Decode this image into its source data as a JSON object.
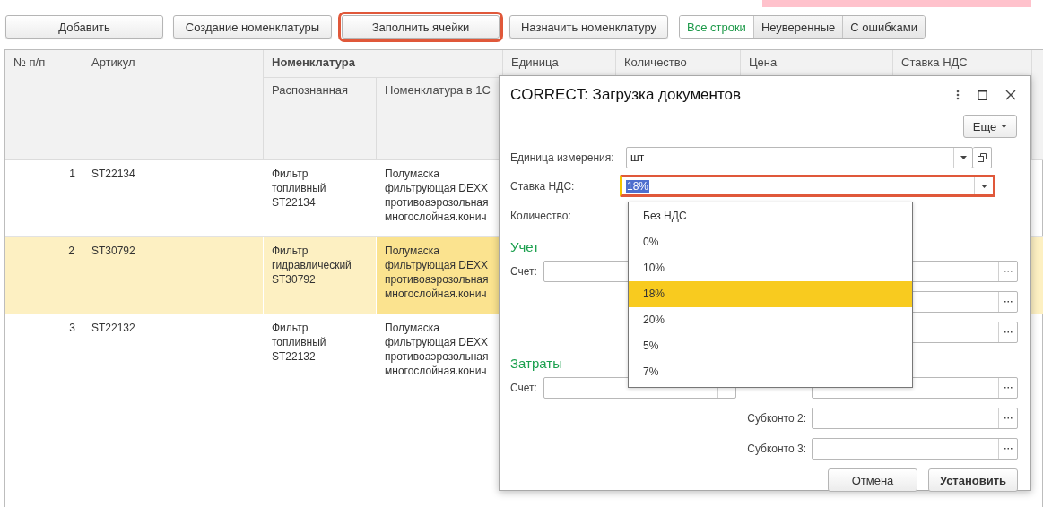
{
  "top_banner": {
    "kind": "strip"
  },
  "toolbar": {
    "buttons": [
      {
        "label": "Добавить",
        "highlighted": false
      },
      {
        "label": "Создание номенклатуры",
        "highlighted": false
      },
      {
        "label": "Заполнить ячейки",
        "highlighted": true
      },
      {
        "label": "Назначить номенклатуру",
        "highlighted": false
      }
    ],
    "filter_tabs": [
      {
        "label": "Все строки",
        "selected": true
      },
      {
        "label": "Неуверенные",
        "selected": false
      },
      {
        "label": "С ошибками",
        "selected": false
      }
    ]
  },
  "table": {
    "columns": {
      "number": "№ п/п",
      "article": "Артикул",
      "nomenclature": "Номенклатура",
      "recognized": "Распознанная",
      "nomenclature_1c": "Номенклатура в 1С",
      "unit": "Единица",
      "quantity": "Количество",
      "price": "Цена",
      "vat_rate": "Ставка НДС"
    },
    "rows": [
      {
        "number": "1",
        "article": "ST22134",
        "recognized": "Фильтр топливный ST22134",
        "nomenclature_1c": "Полумаска фильтрующая DEXX противоаэрозольная многослойная.конич",
        "selected": false
      },
      {
        "number": "2",
        "article": "ST30792",
        "recognized": "Фильтр гидравлический ST30792",
        "nomenclature_1c": "Полумаска фильтрующая DEXX противоаэрозольная многослойная.конич",
        "selected": true
      },
      {
        "number": "3",
        "article": "ST22132",
        "recognized": "Фильтр топливный ST22132",
        "nomenclature_1c": "Полумаска фильтрующая DEXX противоаэрозольная многослойная.конич",
        "selected": false
      }
    ]
  },
  "dialog": {
    "title": "CORRECT: Загрузка документов",
    "more_button": "Еще",
    "unit": {
      "label": "Единица измерения:",
      "value": "шт"
    },
    "vat_rate": {
      "label": "Ставка НДС:",
      "value": "18%",
      "highlighted": true,
      "expanded": true
    },
    "quantity": {
      "label": "Количество:"
    },
    "sections": [
      {
        "heading": "Учет",
        "account_label": "Счет:",
        "subaccounts": [
          {
            "kind": "unlabeled"
          },
          {
            "kind": "unlabeled"
          },
          {
            "kind": "unlabeled"
          }
        ]
      },
      {
        "heading": "Затраты",
        "account_label": "Счет:",
        "subaccounts": [
          {
            "kind": "unlabeled"
          },
          {
            "kind": "labeled",
            "label": "Субконто 2:"
          },
          {
            "kind": "labeled",
            "label": "Субконто 3:"
          }
        ]
      }
    ],
    "buttons": [
      {
        "label": "Отмена",
        "primary": false
      },
      {
        "label": "Установить",
        "primary": true
      }
    ]
  },
  "vat_dropdown": {
    "items": [
      {
        "label": "Без НДС",
        "selected": false
      },
      {
        "label": "0%",
        "selected": false
      },
      {
        "label": "10%",
        "selected": false
      },
      {
        "label": "18%",
        "selected": true
      },
      {
        "label": "20%",
        "selected": false
      },
      {
        "label": "5%",
        "selected": false
      },
      {
        "label": "7%",
        "selected": false
      }
    ]
  }
}
